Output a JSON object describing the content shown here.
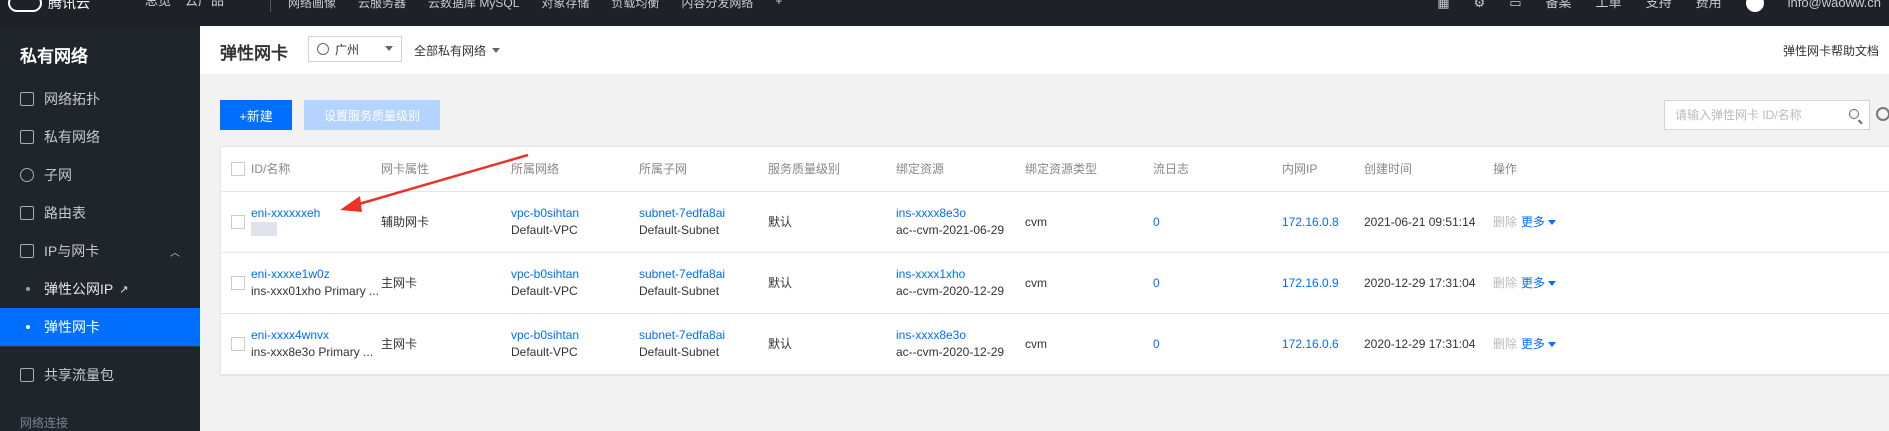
{
  "topnav": {
    "logo": "腾讯云",
    "left_items": [
      "总览",
      "云产品"
    ],
    "mid_items": [
      "网络画像",
      "云服务器",
      "云数据库 MySQL",
      "对象存储",
      "负载均衡",
      "内容分发网络"
    ],
    "right_items": [
      "备案",
      "工单",
      "支持",
      "费用"
    ],
    "user": "info@waoww.cn"
  },
  "sidebar": {
    "title": "私有网络",
    "items": [
      {
        "label": "网络拓扑",
        "icon": "topology-icon"
      },
      {
        "label": "私有网络",
        "icon": "vpc-icon"
      },
      {
        "label": "子网",
        "icon": "subnet-icon"
      },
      {
        "label": "路由表",
        "icon": "route-table-icon"
      },
      {
        "label": "IP与网卡",
        "icon": "ip-nic-icon"
      }
    ],
    "sub_items": [
      {
        "label": "弹性公网IP"
      },
      {
        "label": "弹性网卡"
      }
    ],
    "after_items": [
      {
        "label": "共享流量包",
        "icon": "traffic-package-icon"
      }
    ],
    "section_label": "网络连接"
  },
  "header": {
    "title": "弹性网卡",
    "region": "广州",
    "vpc_filter": "全部私有网络",
    "help": "弹性网卡帮助文档"
  },
  "toolbar": {
    "new_label": "+新建",
    "qos_label": "设置服务质量级别",
    "search_placeholder": "请输入弹性网卡 ID/名称"
  },
  "table": {
    "columns": [
      "ID/名称",
      "网卡属性",
      "所属网络",
      "所属子网",
      "服务质量级别",
      "绑定资源",
      "绑定资源类型",
      "流日志",
      "内网IP",
      "创建时间",
      "操作"
    ],
    "rows": [
      {
        "id_line1": "eni-xxxxxxeh",
        "id_line2": "",
        "attr": "辅助网卡",
        "vpc_id": "vpc-b0sihtan",
        "vpc_name": "Default-VPC",
        "subnet_id": "subnet-7edfa8ai",
        "subnet_name": "Default-Subnet",
        "qos": "默认",
        "res_line1": "ins-xxxx8e3o",
        "res_line2": "ac--cvm-2021-06-29",
        "res_type": "cvm",
        "flow_log": "0",
        "ip": "172.16.0.8",
        "created": "2021-06-21 09:51:14",
        "op_delete": "删除",
        "op_more": "更多"
      },
      {
        "id_line1": "eni-xxxxe1w0z",
        "id_line2": "ins-xxx01xho Primary ...",
        "attr": "主网卡",
        "vpc_id": "vpc-b0sihtan",
        "vpc_name": "Default-VPC",
        "subnet_id": "subnet-7edfa8ai",
        "subnet_name": "Default-Subnet",
        "qos": "默认",
        "res_line1": "ins-xxxx1xho",
        "res_line2": "ac--cvm-2020-12-29",
        "res_type": "cvm",
        "flow_log": "0",
        "ip": "172.16.0.9",
        "created": "2020-12-29 17:31:04",
        "op_delete": "删除",
        "op_more": "更多"
      },
      {
        "id_line1": "eni-xxxx4wnvx",
        "id_line2": "ins-xxx8e3o Primary ...",
        "attr": "主网卡",
        "vpc_id": "vpc-b0sihtan",
        "vpc_name": "Default-VPC",
        "subnet_id": "subnet-7edfa8ai",
        "subnet_name": "Default-Subnet",
        "qos": "默认",
        "res_line1": "ins-xxxx8e3o",
        "res_line2": "ac--cvm-2020-12-29",
        "res_type": "cvm",
        "flow_log": "0",
        "ip": "172.16.0.6",
        "created": "2020-12-29 17:31:04",
        "op_delete": "删除",
        "op_more": "更多"
      }
    ]
  },
  "colors": {
    "accent": "#006eff",
    "sidebar_bg": "#20242b",
    "annotation_arrow": "#e8322a"
  }
}
